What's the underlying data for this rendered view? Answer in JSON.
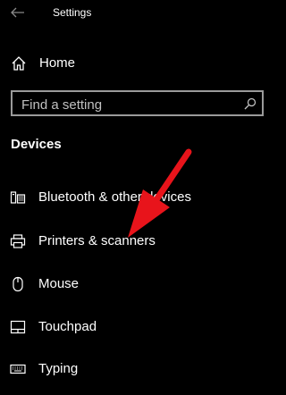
{
  "window": {
    "title": "Settings"
  },
  "nav": {
    "home_label": "Home"
  },
  "search": {
    "placeholder": "Find a setting"
  },
  "section": {
    "heading": "Devices"
  },
  "items": [
    {
      "label": "Bluetooth & other devices",
      "icon": "bluetooth-devices-icon"
    },
    {
      "label": "Printers & scanners",
      "icon": "printer-icon"
    },
    {
      "label": "Mouse",
      "icon": "mouse-icon"
    },
    {
      "label": "Touchpad",
      "icon": "touchpad-icon"
    },
    {
      "label": "Typing",
      "icon": "keyboard-icon"
    }
  ],
  "colors": {
    "background": "#000000",
    "text": "#ffffff",
    "search_border": "#9a9a9a",
    "annotation_arrow": "#e8141b"
  }
}
